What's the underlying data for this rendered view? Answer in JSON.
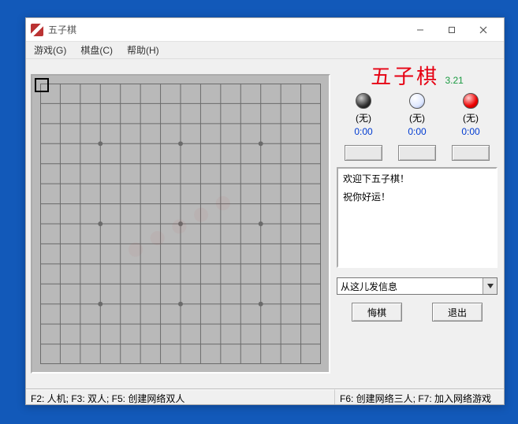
{
  "window": {
    "title": "五子棋"
  },
  "menu": {
    "game": "游戏(G)",
    "board": "棋盘(C)",
    "help": "帮助(H)"
  },
  "heading": {
    "name": "五子棋",
    "version": "3.21"
  },
  "players": [
    {
      "piece": "black",
      "name": "(无)",
      "time": "0:00"
    },
    {
      "piece": "white",
      "name": "(无)",
      "time": "0:00"
    },
    {
      "piece": "red",
      "name": "(无)",
      "time": "0:00"
    }
  ],
  "log": [
    "欢迎下五子棋！",
    "祝你好运！"
  ],
  "combo": {
    "placeholder": "从这儿发信息"
  },
  "buttons": {
    "undo": "悔棋",
    "exit": "退出"
  },
  "status": {
    "left": "F2: 人机;  F3: 双人;  F5: 创建网络双人",
    "right": "F6: 创建网络三人;  F7: 加入网络游戏"
  },
  "board": {
    "size": 15,
    "star_points": [
      [
        3,
        3
      ],
      [
        11,
        3
      ],
      [
        3,
        11
      ],
      [
        11,
        11
      ],
      [
        7,
        7
      ],
      [
        7,
        3
      ],
      [
        3,
        7
      ],
      [
        11,
        7
      ],
      [
        7,
        11
      ]
    ]
  }
}
